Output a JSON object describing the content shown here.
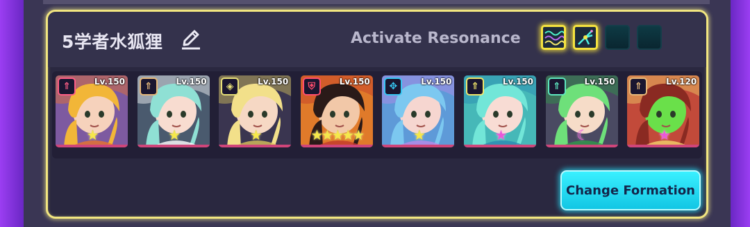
{
  "team": {
    "name": "5学者水狐狸",
    "edit_icon": "pencil-edit-icon"
  },
  "resonance": {
    "label": "Activate Resonance",
    "slots": [
      {
        "state": "active",
        "icon": "wave-resonance-icon"
      },
      {
        "state": "active",
        "icon": "spark-resonance-icon"
      },
      {
        "state": "empty"
      },
      {
        "state": "empty"
      }
    ],
    "active_color": "#f5e33f"
  },
  "roster": [
    {
      "level": "Lv.150",
      "role_icon": "attacker-arrow-icon",
      "role_color": "#ff5e86",
      "stars": "★",
      "star_color": "yellow",
      "art": {
        "bg": "#7d5aa0",
        "hair": "#f2b638",
        "skin": "#f6d2bc",
        "accent": "#e8742a"
      }
    },
    {
      "level": "Lv.150",
      "role_icon": "attacker-arrow-icon",
      "role_color": "#e6b87a",
      "stars": "★",
      "star_color": "yellow",
      "art": {
        "bg": "#4a5a6e",
        "hair": "#8fe0d4",
        "skin": "#f8dcd0",
        "accent": "#ffffff"
      }
    },
    {
      "level": "Lv.150",
      "role_icon": "support-diamond-icon",
      "role_color": "#e8e078",
      "stars": "★",
      "star_color": "yellow",
      "art": {
        "bg": "#3a3550",
        "hair": "#f2e08a",
        "skin": "#f6d8c4",
        "accent": "#d8c35a"
      }
    },
    {
      "level": "Lv.150",
      "role_icon": "defender-shield-icon",
      "role_color": "#ff4e6e",
      "stars": "★★★★★",
      "star_color": "yellow",
      "art": {
        "bg": "#e07a2a",
        "hair": "#2a1a18",
        "skin": "#f2c8a8",
        "accent": "#c23a2a"
      }
    },
    {
      "level": "Lv.150",
      "role_icon": "ranger-bow-icon",
      "role_color": "#36c6f2",
      "stars": "★",
      "star_color": "yellow",
      "art": {
        "bg": "#5e9ad8",
        "hair": "#7cc8f0",
        "skin": "#f6d6d0",
        "accent": "#b88ae8"
      }
    },
    {
      "level": "Lv.150",
      "role_icon": "attacker-arrow-icon",
      "role_color": "#f2e66a",
      "stars": "★",
      "star_color": "pink",
      "art": {
        "bg": "#46b8b8",
        "hair": "#72e6d8",
        "skin": "#f8dcd4",
        "accent": "#2a8ab2"
      }
    },
    {
      "level": "Lv.150",
      "role_icon": "attacker-arrow-icon",
      "role_color": "#5ee8c0",
      "stars": "☾",
      "star_color": "pink",
      "art": {
        "bg": "#4a4a62",
        "hair": "#6ee07a",
        "skin": "#f6dcc8",
        "accent": "#2f9a4a"
      }
    },
    {
      "level": "Lv.120",
      "role_icon": "attacker-arrow-icon",
      "role_color": "#e6b87a",
      "stars": "★",
      "star_color": "pink",
      "art": {
        "bg": "#c24a3a",
        "hair": "#8a2a22",
        "skin": "#6ae04a",
        "accent": "#f2d26a"
      }
    }
  ],
  "actions": {
    "change_formation_label": "Change Formation"
  }
}
